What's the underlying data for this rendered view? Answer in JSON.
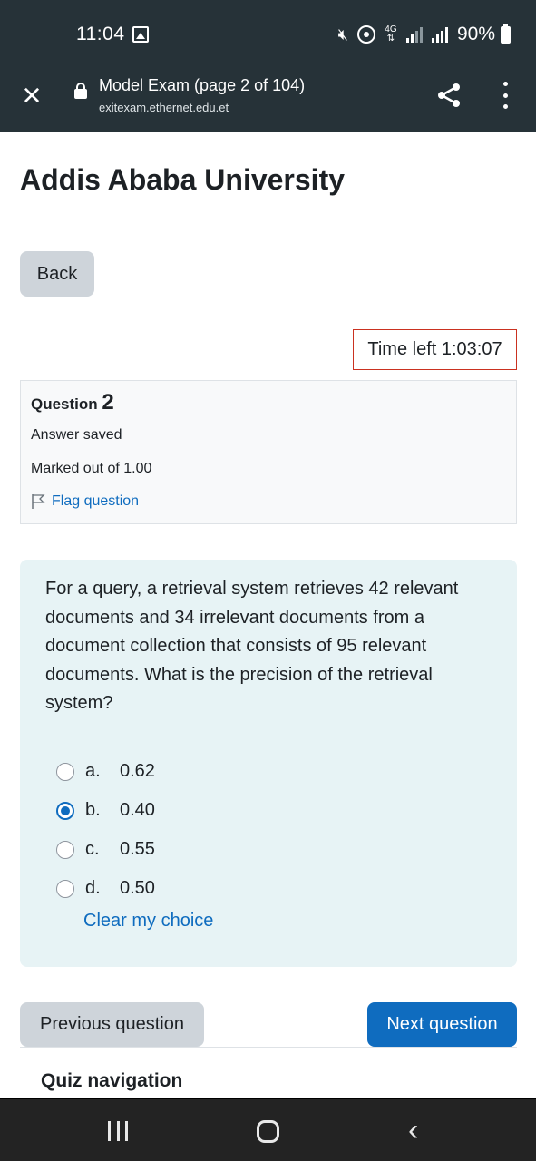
{
  "status_bar": {
    "time": "11:04",
    "network_label": "4G",
    "battery": "90%",
    "icons": [
      "gallery-icon",
      "mute-icon",
      "hotspot-icon",
      "lte-icon",
      "signal-icon",
      "signal-icon",
      "battery-icon"
    ]
  },
  "toolbar": {
    "title": "Model Exam (page 2 of 104)",
    "url": "exitexam.ethernet.edu.et",
    "icons": [
      "close-icon",
      "lock-icon",
      "share-icon",
      "more-icon"
    ]
  },
  "page": {
    "heading": "Addis Ababa University",
    "back_label": "Back",
    "timer": "Time left 1:03:07"
  },
  "question_info": {
    "label": "Question",
    "number": "2",
    "state": "Answer saved",
    "mark": "Marked out of 1.00",
    "flag_label": "Flag question"
  },
  "question": {
    "text": "For a query, a retrieval system retrieves 42 relevant documents and 34 irrelevant documents from a document collection that consists of 95 relevant documents. What is the precision of the retrieval system?",
    "answers": [
      {
        "letter": "a.",
        "value": "0.62",
        "selected": false
      },
      {
        "letter": "b.",
        "value": "0.40",
        "selected": true
      },
      {
        "letter": "c.",
        "value": "0.55",
        "selected": false
      },
      {
        "letter": "d.",
        "value": "0.50",
        "selected": false
      }
    ],
    "clear_label": "Clear my choice"
  },
  "navigation": {
    "previous_label": "Previous question",
    "next_label": "Next question",
    "quiz_nav_heading": "Quiz navigation"
  },
  "colors": {
    "header_bg": "#263238",
    "link": "#0f6cbf",
    "question_bg": "#e7f3f5",
    "timer_border": "#ca3120"
  }
}
